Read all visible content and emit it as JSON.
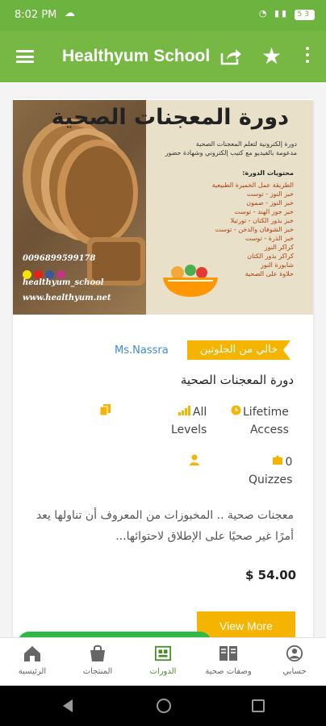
{
  "status_bar": {
    "time": "8:02 PM",
    "battery": "53"
  },
  "app_bar": {
    "title": "Healthyum School"
  },
  "course": {
    "banner": {
      "title": "دورة المعجنات الصحية",
      "subtitle_line1": "دورة إلكترونية لتعلم المعجنات الصحية",
      "subtitle_line2": "مدعومة بالفيديو مع كتيب إلكتروني وشهادة حضور",
      "contents_heading": "محتويات الدورة:",
      "contents": [
        "الطريقة عمل الخميرة الطبيعية",
        "خبز النوز - توست",
        "خبز النوز - صمون",
        "خبز جوز الهند - توست",
        "خبز بذور الكتان - تورتيلا",
        "خبز الشوفان والدخن - توست",
        "خبز الذرة - توست",
        "كراكر النوز",
        "كراكر بذور الكتان",
        "شابورة النوز",
        "حلاوة على الصحية"
      ],
      "phone": "0096899599178",
      "handle": "healthyum_school",
      "website": "www.healthyum.net"
    },
    "badge": "خالي من الجلوتين",
    "instructor": "Ms.Nassra",
    "title": "دورة المعجنات الصحية",
    "features": {
      "access_line1": "Lifetime",
      "access_line2": "Access",
      "levels_line1": "All",
      "levels_line2": "Levels",
      "quizzes_line1": "0",
      "quizzes_line2": "Quizzes"
    },
    "description": "معجنات صحية .. المخبوزات من المعروف أن تناولها يعد أمرًا غير صحيًا على الإطلاق لاحتوائها...",
    "price": "$ 54.00",
    "view_more": "View More"
  },
  "bottom_nav": {
    "items": [
      {
        "label": "حسابي",
        "icon": "account-icon"
      },
      {
        "label": "وصفات صحية",
        "icon": "recipes-book-icon"
      },
      {
        "label": "الدورات",
        "icon": "courses-icon"
      },
      {
        "label": "المنتجات",
        "icon": "products-icon"
      },
      {
        "label": "الرئيسية",
        "icon": "home-icon"
      }
    ],
    "active": "الدورات"
  },
  "colors": {
    "primary_green": "#76b843",
    "accent_yellow": "#f4b400",
    "link_blue": "#3f8ccf"
  }
}
